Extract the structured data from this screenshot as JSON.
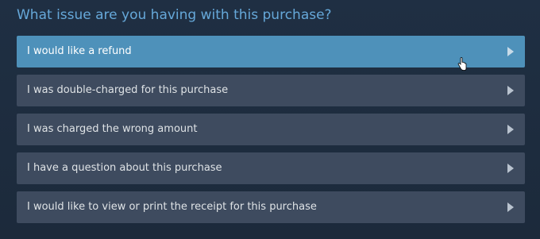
{
  "question": "What issue are you having with this purchase?",
  "options": [
    {
      "label": "I would like a refund"
    },
    {
      "label": "I was double-charged for this purchase"
    },
    {
      "label": "I was charged the wrong amount"
    },
    {
      "label": "I have a question about this purchase"
    },
    {
      "label": "I would like to view or print the receipt for this purchase"
    }
  ],
  "icons": {
    "option_arrow": "chevron-right-icon",
    "cursor": "hand-pointer-icon"
  },
  "colors": {
    "background": "#1b2838",
    "title": "#66a8d9",
    "option": "#3e4b5f",
    "option_active": "#4e91ba",
    "option_text": "#dfe3e6"
  }
}
